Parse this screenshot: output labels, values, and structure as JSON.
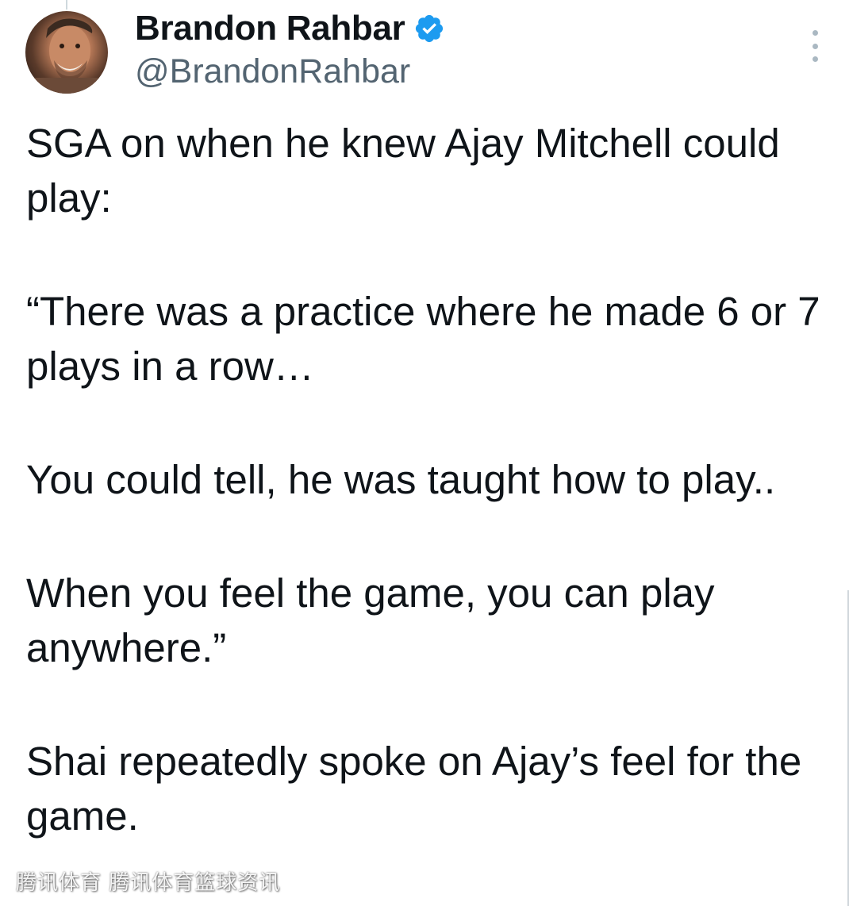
{
  "author": {
    "display_name": "Brandon Rahbar",
    "handle": "@BrandonRahbar",
    "verified": true
  },
  "tweet": {
    "paragraphs": [
      "SGA on when he knew Ajay Mitchell could play:",
      "“There was a practice where he made 6 or 7 plays in a row…",
      "You could tell, he was taught how to play..",
      "When you feel the game, you can play anywhere.”",
      "Shai repeatedly spoke on Ajay’s feel for the game."
    ]
  },
  "watermark": {
    "text": "腾讯体育 腾讯体育篮球资讯"
  },
  "icons": {
    "verified": "verified-badge-icon",
    "more": "more-options-icon"
  },
  "colors": {
    "text": "#0f1419",
    "secondary": "#536471",
    "verified_blue": "#1d9bf0"
  }
}
